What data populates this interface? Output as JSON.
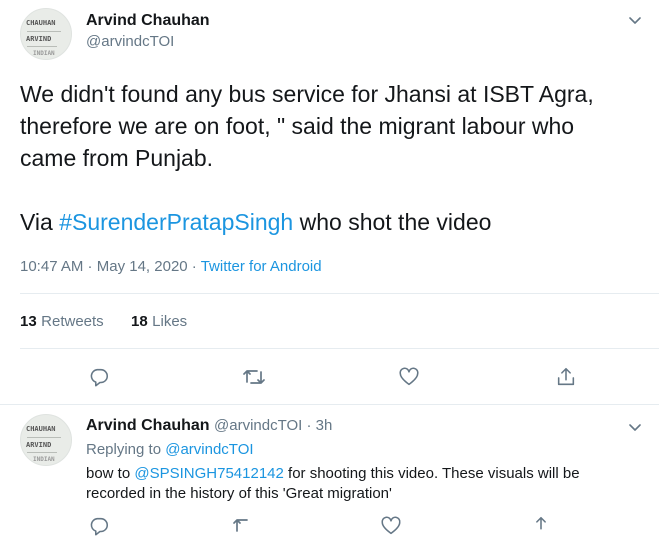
{
  "main_tweet": {
    "author_name": "Arvind Chauhan",
    "author_handle": "@arvindcTOI",
    "avatar_lines": [
      "CHAUHAN",
      "ARVIND",
      "INDIAN"
    ],
    "text_line1": "We didn't found any bus service for Jhansi at ISBT Agra,",
    "text_line2": "therefore we are on foot, \" said the migrant labour who",
    "text_line3": "came from Punjab.",
    "via_prefix": "Via ",
    "via_hashtag": "#SurenderPratapSingh",
    "via_suffix": " who shot the video",
    "time": "10:47 AM",
    "sep1": " · ",
    "date": "May 14, 2020",
    "sep2": " · ",
    "source": "Twitter for Android",
    "retweets_count": "13",
    "retweets_label": "Retweets",
    "likes_count": "18",
    "likes_label": "Likes"
  },
  "reply_tweet": {
    "author_name": "Arvind Chauhan",
    "author_handle": "@arvindcTOI",
    "time_sep": " · ",
    "time_ago": "3h",
    "replying_prefix": "Replying to ",
    "replying_handle": "@arvindcTOI",
    "avatar_lines": [
      "CHAUHAN",
      "ARVIND",
      "INDIAN"
    ],
    "text_prefix": "bow to ",
    "text_mention": "@SPSINGH75412142",
    "text_suffix1": " for shooting this video. These visuals will be",
    "text_line2": "recorded in the history of  this 'Great migration'"
  },
  "colors": {
    "link": "#1b95e0",
    "secondary_text": "#657786",
    "primary_text": "#14171a",
    "divider": "#e6ecf0"
  },
  "icons": [
    "chevron-down-icon",
    "reply-icon",
    "retweet-icon",
    "like-icon",
    "share-icon"
  ]
}
